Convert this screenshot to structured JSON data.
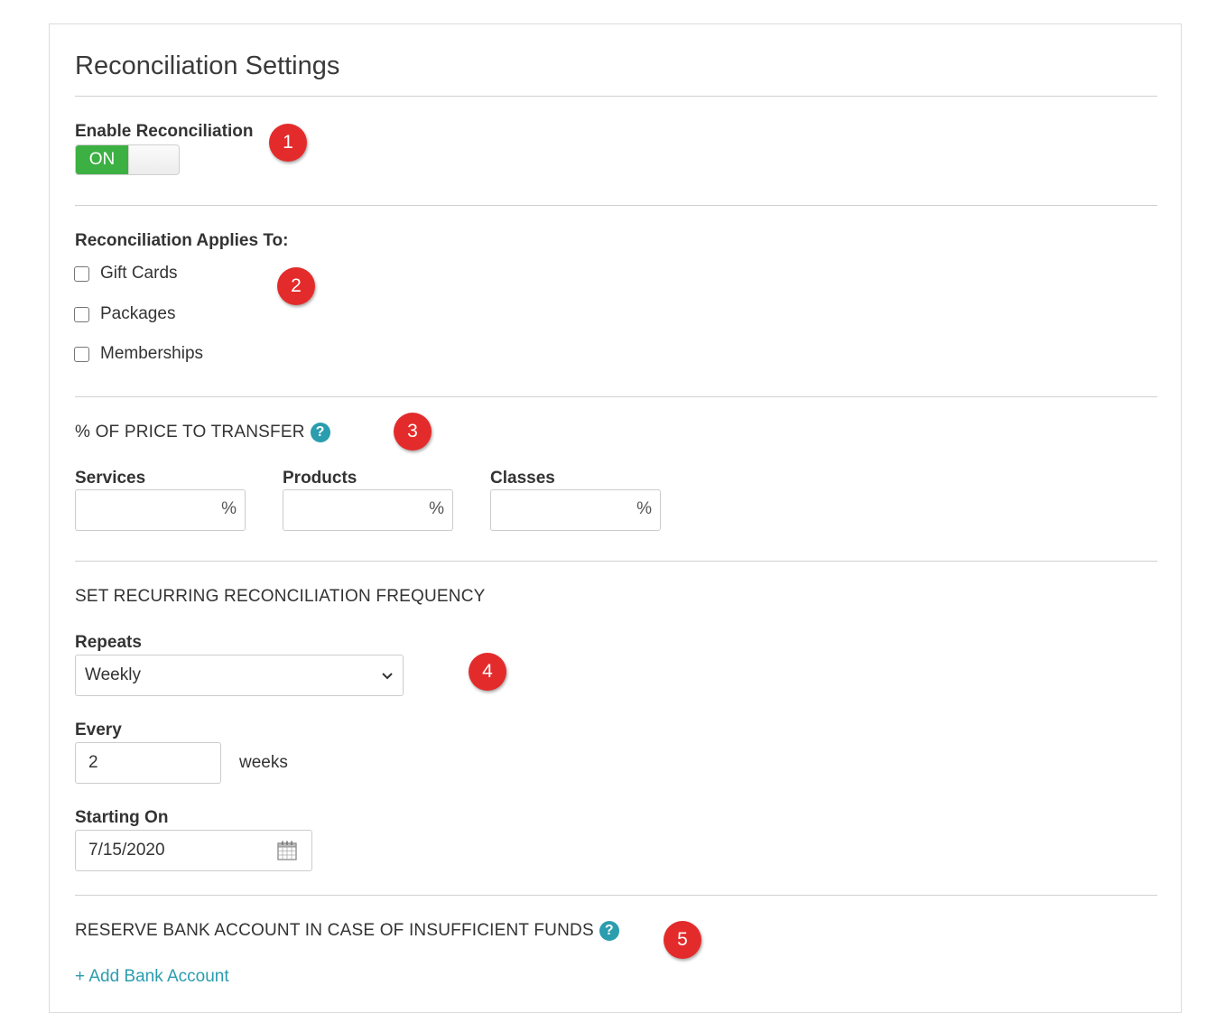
{
  "title": "Reconciliation Settings",
  "enable": {
    "label": "Enable Reconciliation",
    "toggle_text": "ON"
  },
  "applies": {
    "label": "Reconciliation Applies To:",
    "options": [
      {
        "label": "Gift Cards",
        "checked": false
      },
      {
        "label": "Packages",
        "checked": false
      },
      {
        "label": "Memberships",
        "checked": false
      }
    ]
  },
  "price_transfer": {
    "heading": "% OF PRICE TO TRANSFER",
    "help_icon": "question-circle-icon",
    "fields": [
      {
        "label": "Services",
        "value": "",
        "unit": "%"
      },
      {
        "label": "Products",
        "value": "",
        "unit": "%"
      },
      {
        "label": "Classes",
        "value": "",
        "unit": "%"
      }
    ]
  },
  "frequency": {
    "heading": "SET RECURRING RECONCILIATION FREQUENCY",
    "repeats_label": "Repeats",
    "repeats_value": "Weekly",
    "every_label": "Every",
    "every_value": "2",
    "every_unit": "weeks",
    "starting_label": "Starting On",
    "starting_value": "7/15/2020"
  },
  "reserve": {
    "heading": "RESERVE BANK ACCOUNT IN CASE OF INSUFFICIENT FUNDS",
    "help_icon": "question-circle-icon",
    "add_link": "+ Add Bank Account"
  },
  "badges": [
    "1",
    "2",
    "3",
    "4",
    "5"
  ],
  "colors": {
    "toggle_on": "#3cb043",
    "accent": "#2a9dae",
    "badge": "#e42b2b"
  }
}
